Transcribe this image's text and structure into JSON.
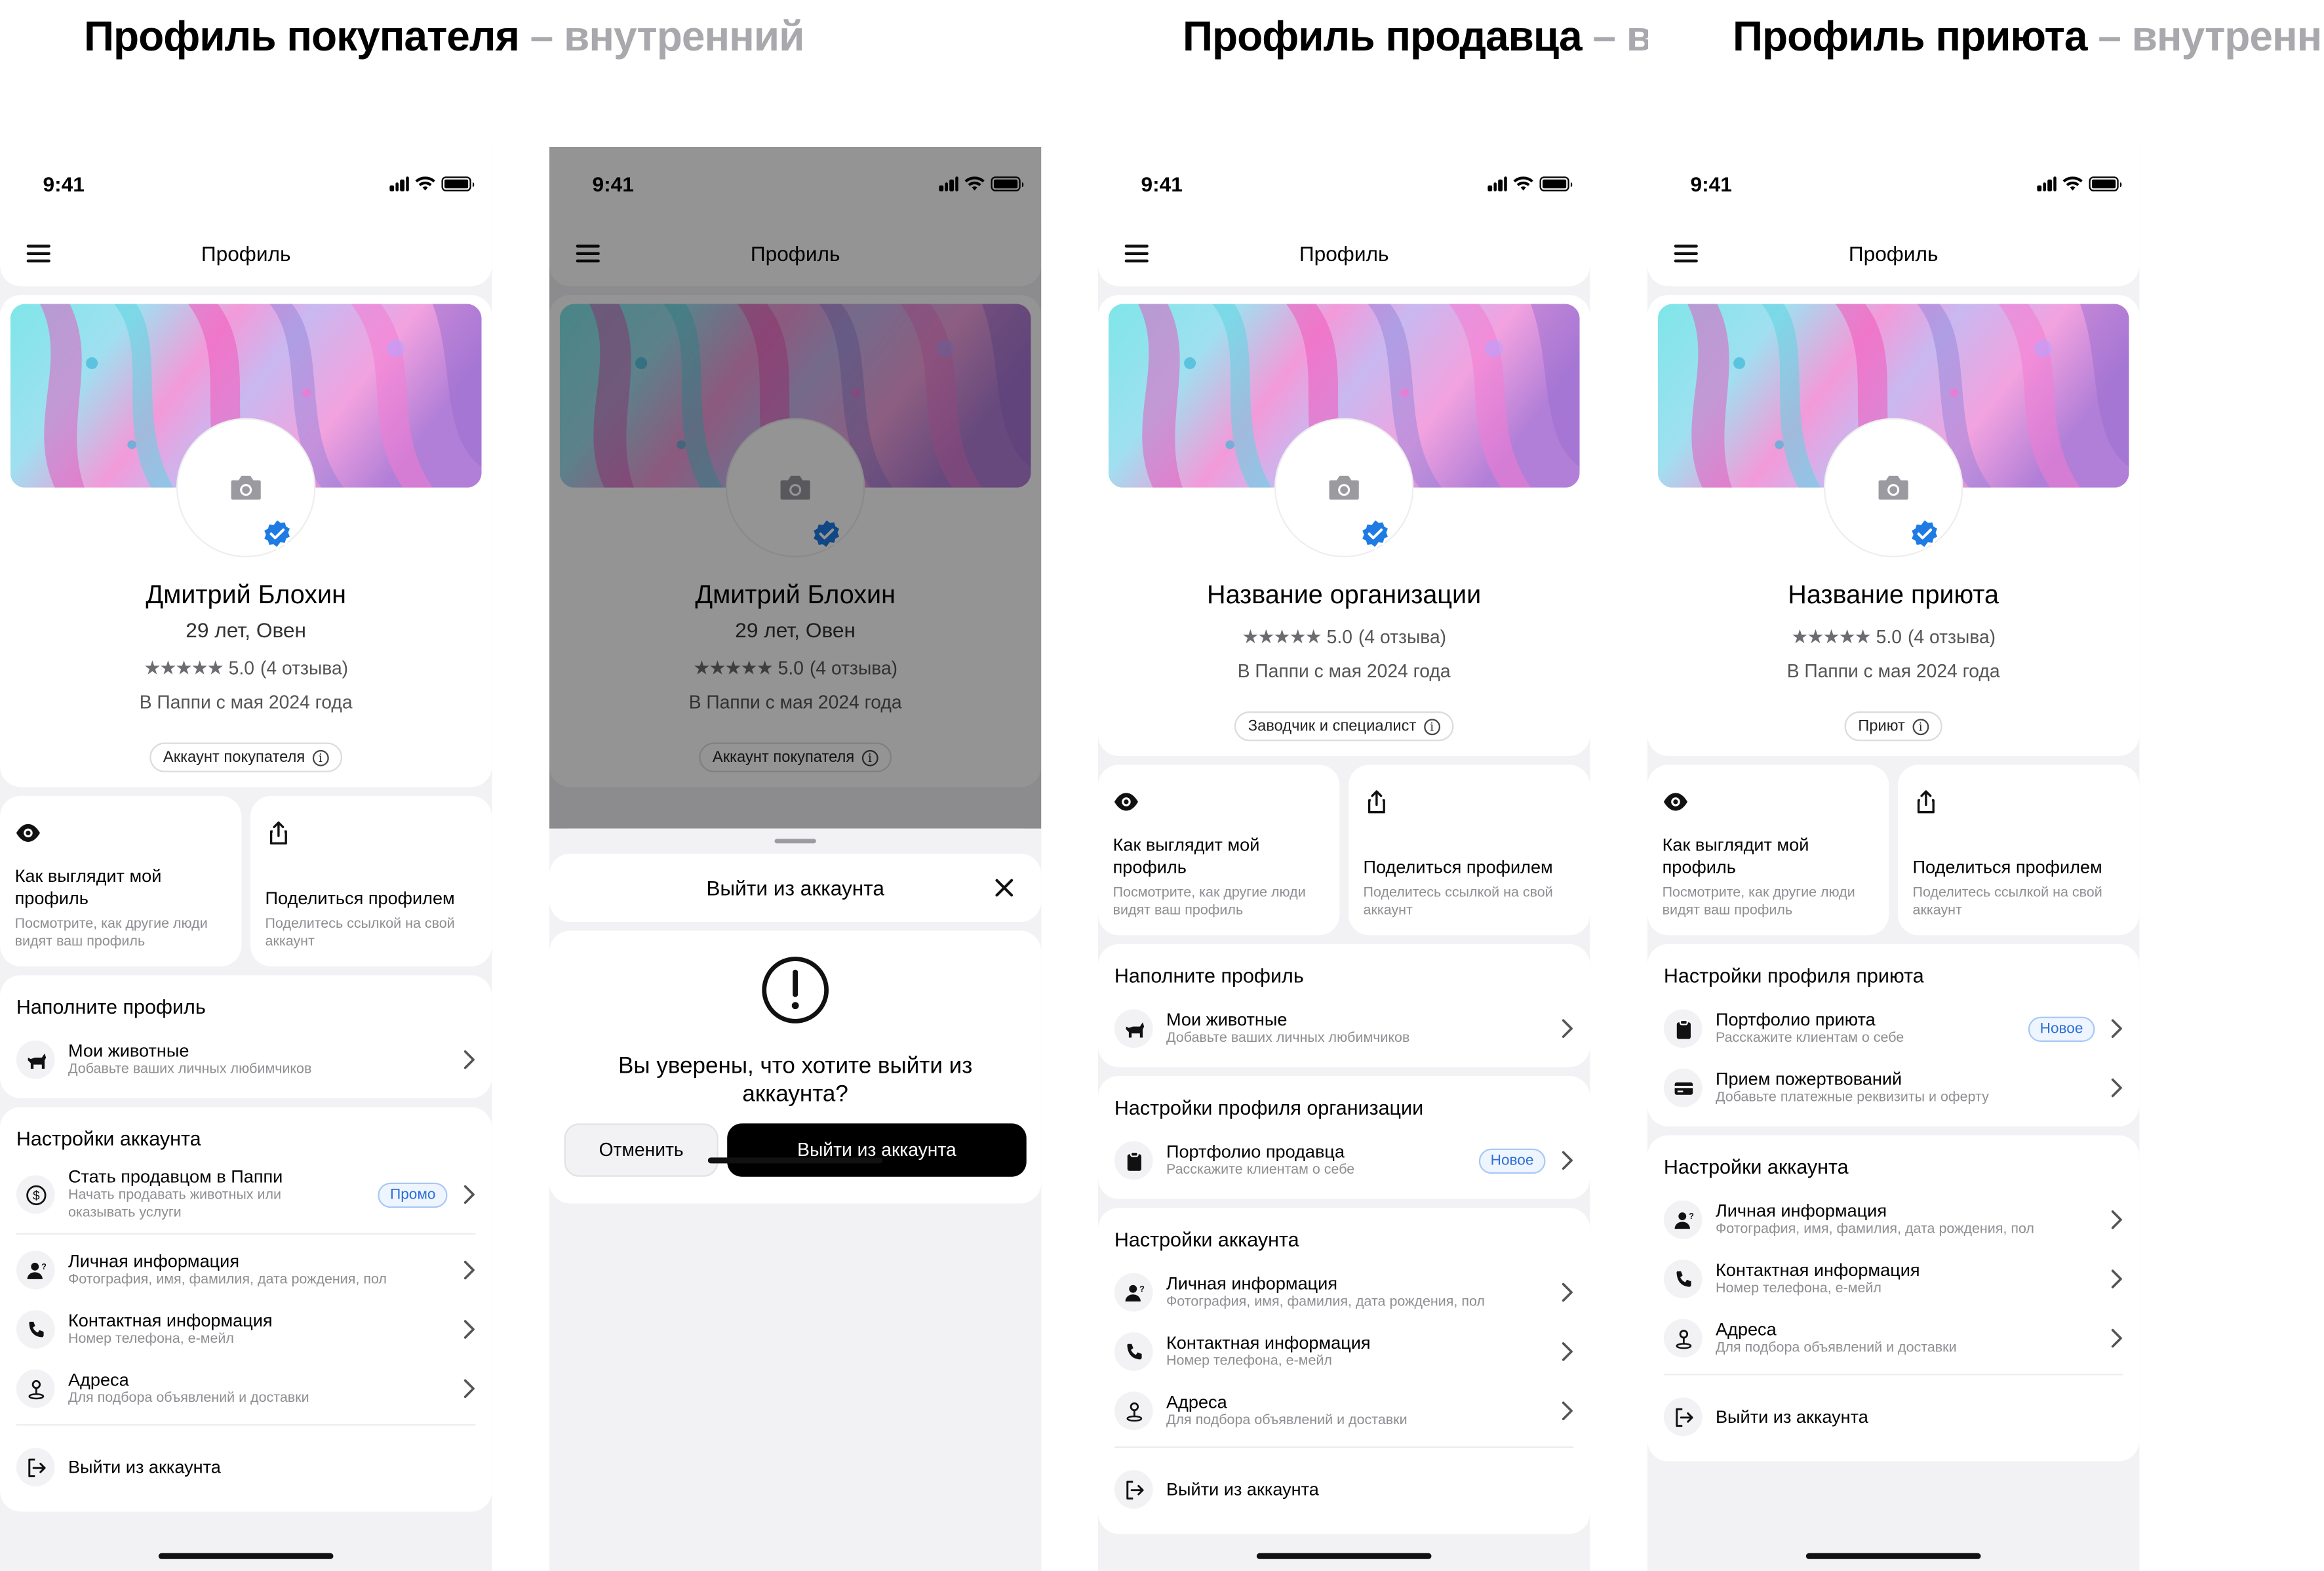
{
  "titles": {
    "buyer": {
      "main": "Профиль покупателя",
      "sub": " – внутренний"
    },
    "seller": {
      "main": "Профиль продавца",
      "sub": " – вну"
    },
    "shelter": {
      "main": "Профиль приюта",
      "sub": " – внутренний"
    }
  },
  "status_time": "9:41",
  "nav_title": "Профиль",
  "colors": {
    "accent_blue": "#2b6fd6",
    "verified_blue": "#1e7be4",
    "dark_button": "#000000"
  },
  "buyer": {
    "name": "Дмитрий Блохин",
    "age": "29 лет, Овен",
    "stars": "★★★★★",
    "rating": "5.0",
    "reviews": "(4 отзыва)",
    "since": "В Паппи с мая 2024 года",
    "chip": "Аккаунт покупателя",
    "tile_view_title": "Как выглядит мой профиль",
    "tile_view_sub": "Посмотрите, как другие люди видят ваш профиль",
    "tile_share_title": "Поделиться профилем",
    "tile_share_sub": "Поделитесь ссылкой на свой аккаунт",
    "fill_title": "Наполните профиль",
    "pets_title": "Мои животные",
    "pets_sub": "Добавьте ваших личных любимчиков",
    "account_title": "Настройки аккаунта",
    "seller_title": "Стать продавцом в Паппи",
    "seller_sub": "Начать продавать животных или оказывать услуги",
    "promo": "Промо",
    "personal_title": "Личная информация",
    "personal_sub": "Фотография, имя, фамилия, дата рождения, пол",
    "contact_title": "Контактная информация",
    "contact_sub": "Номер телефона, е-мейл",
    "address_title": "Адреса",
    "address_sub": "Для подбора объявлений и доставки",
    "logout": "Выйти из аккаунта"
  },
  "modal": {
    "title": "Выйти из аккаунта",
    "question": "Вы уверены, что хотите выйти из аккаунта?",
    "cancel": "Отменить",
    "confirm": "Выйти из аккаунта"
  },
  "seller": {
    "name": "Название организации",
    "stars": "★★★★★",
    "rating": "5.0",
    "reviews": "(4 отзыва)",
    "since": "В Паппи с мая 2024 года",
    "chip": "Заводчик и специалист",
    "tile_view_title": "Как выглядит мой профиль",
    "tile_view_sub": "Посмотрите, как другие люди видят ваш профиль",
    "tile_share_title": "Поделиться профилем",
    "tile_share_sub": "Поделитесь ссылкой на свой аккаунт",
    "fill_title": "Наполните профиль",
    "pets_title": "Мои животные",
    "pets_sub": "Добавьте ваших личных любимчиков",
    "org_title": "Настройки профиля организации",
    "portfolio_title": "Портфолио продавца",
    "portfolio_sub": "Расскажите клиентам о себе",
    "new_badge": "Новое",
    "account_title": "Настройки аккаунта",
    "personal_title": "Личная информация",
    "personal_sub": "Фотография, имя, фамилия, дата рождения, пол",
    "contact_title": "Контактная информация",
    "contact_sub": "Номер телефона, е-мейл",
    "address_title": "Адреса",
    "address_sub": "Для подбора объявлений и доставки",
    "logout": "Выйти из аккаунта"
  },
  "shelter": {
    "name": "Название приюта",
    "stars": "★★★★★",
    "rating": "5.0",
    "reviews": "(4 отзыва)",
    "since": "В Паппи с мая 2024 года",
    "chip": "Приют",
    "tile_view_title": "Как выглядит мой профиль",
    "tile_view_sub": "Посмотрите, как другие люди видят ваш профиль",
    "tile_share_title": "Поделиться профилем",
    "tile_share_sub": "Поделитесь ссылкой на свой аккаунт",
    "shelter_settings_title": "Настройки профиля приюта",
    "portfolio_title": "Портфолио приюта",
    "portfolio_sub": "Расскажите клиентам о себе",
    "new_badge": "Новое",
    "donation_title": "Прием пожертвований",
    "donation_sub": "Добавьте платежные реквизиты и оферту",
    "account_title": "Настройки аккаунта",
    "personal_title": "Личная информация",
    "personal_sub": "Фотография, имя, фамилия, дата рождения, пол",
    "contact_title": "Контактная информация",
    "contact_sub": "Номер телефона, е-мейл",
    "address_title": "Адреса",
    "address_sub": "Для подбора объявлений и доставки",
    "logout": "Выйти из аккаунта"
  }
}
